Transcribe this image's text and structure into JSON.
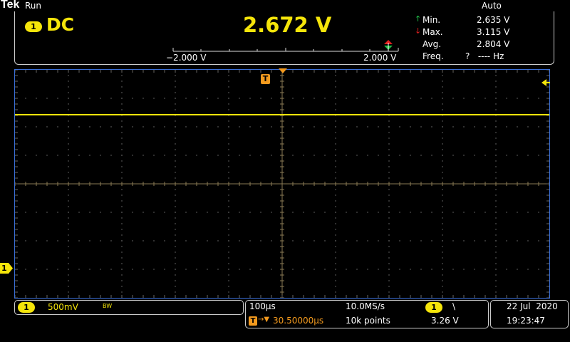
{
  "header": {
    "brand": "Tek",
    "status": "Run",
    "trigger_mode": "Auto"
  },
  "readout": {
    "channel": "1",
    "coupling": "DC",
    "value": "2.672 V",
    "stats": [
      {
        "label": "Min.",
        "value": "2.635 V"
      },
      {
        "label": "Max.",
        "value": "3.115 V"
      },
      {
        "label": "Avg.",
        "value": "2.804 V"
      },
      {
        "label": "Freq.",
        "value": "?   ---- Hz"
      }
    ],
    "scale_min": "−2.000 V",
    "scale_max": "2.000 V"
  },
  "graticule": {
    "trigger_marker": "T",
    "channel_marker": "1",
    "trace_color": "#f5e50a",
    "grid_color": "#ffffff"
  },
  "channel_box": {
    "channel": "1",
    "volts_per_div": "500mV",
    "bw_flag": "BW"
  },
  "horizontal": {
    "time_per_div": "100µs",
    "trigger_pos_icon": "T",
    "trigger_offset": "30.50000µs",
    "sample_rate": "10.0MS/s",
    "record_length": "10k points",
    "trigger_channel": "1",
    "trigger_slope": "\\",
    "trigger_level": "3.26 V"
  },
  "clock": {
    "date": "22 Jul  2020",
    "time": "19:23:47"
  }
}
